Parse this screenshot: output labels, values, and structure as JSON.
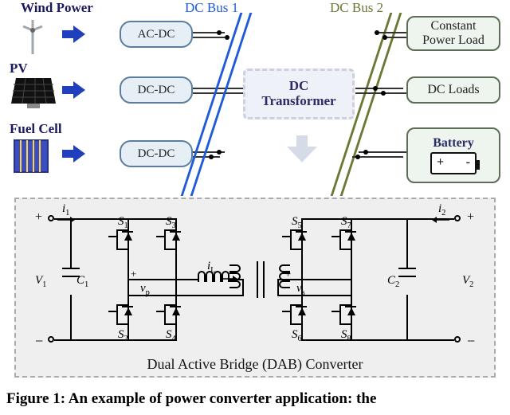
{
  "sources": {
    "wind": {
      "label": "Wind Power",
      "conv": "AC-DC"
    },
    "pv": {
      "label": "PV",
      "conv": "DC-DC"
    },
    "fuel": {
      "label": "Fuel Cell",
      "conv": "DC-DC"
    }
  },
  "buses": {
    "left": {
      "label": "DC Bus 1",
      "color": "#1f5bd8"
    },
    "right": {
      "label": "DC Bus 2",
      "color": "#6a7a35"
    }
  },
  "center": {
    "dc_transformer_l1": "DC",
    "dc_transformer_l2": "Transformer"
  },
  "loads": {
    "cpl": {
      "l1": "Constant",
      "l2": "Power Load"
    },
    "dcl": {
      "label": "DC Loads"
    },
    "batt": {
      "label": "Battery",
      "plus": "+",
      "minus": "-"
    }
  },
  "dab": {
    "caption": "Dual Active Bridge (DAB) Converter",
    "i1": "i",
    "i1sub": "1",
    "i2": "i",
    "i2sub": "2",
    "V1": "V",
    "V1sub": "1",
    "V2": "V",
    "V2sub": "2",
    "C1": "C",
    "C1sub": "1",
    "C2": "C",
    "C2sub": "2",
    "vp": "v",
    "vpsub": "p",
    "vs": "v",
    "vssub": "s",
    "iL": "i",
    "iLsub": "L",
    "plus": "+",
    "minus": "−",
    "S": "S",
    "S1sub": "1",
    "S2sub": "2",
    "S3sub": "3",
    "S4sub": "4",
    "S5sub": "5",
    "S6sub": "6",
    "S7sub": "7",
    "S8sub": "8"
  },
  "figure_caption": "Figure 1: An example of power converter application: the"
}
